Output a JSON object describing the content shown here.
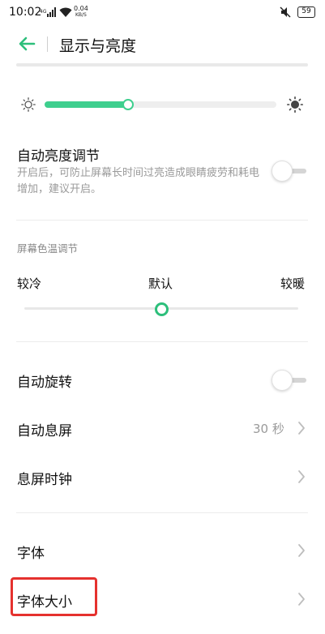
{
  "status_bar": {
    "time": "10:02",
    "network": "4G",
    "speed_value": "0.04",
    "speed_unit": "KB/S",
    "battery": "59",
    "icons": [
      "signal-icon",
      "wifi-icon",
      "mute-icon",
      "battery-icon"
    ]
  },
  "header": {
    "title": "显示与亮度",
    "back_icon": "back-arrow-icon"
  },
  "brightness": {
    "level_fraction": 0.36,
    "accent": "#3ecf8e"
  },
  "auto_brightness": {
    "label": "自动亮度调节",
    "description": "开启后，可防止屏幕长时间过亮造成眼睛疲劳和耗电增加，建议开启。",
    "enabled": false
  },
  "color_temp": {
    "section_label": "屏幕色温调节",
    "cool_label": "较冷",
    "default_label": "默认",
    "warm_label": "较暖",
    "position_fraction": 0.5,
    "accent": "#2dbf7b"
  },
  "auto_rotate": {
    "label": "自动旋转",
    "enabled": false
  },
  "screen_timeout": {
    "label": "自动息屏",
    "value": "30 秒"
  },
  "screen_off_clock": {
    "label": "息屏时钟"
  },
  "font": {
    "label": "字体"
  },
  "font_size": {
    "label": "字体大小",
    "highlight_color": "#e5312e"
  }
}
